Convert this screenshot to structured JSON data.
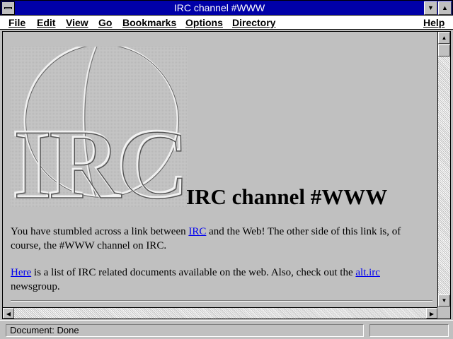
{
  "window": {
    "title": "IRC channel #WWW"
  },
  "menu": {
    "file": "File",
    "edit": "Edit",
    "view": "View",
    "go": "Go",
    "bookmarks": "Bookmarks",
    "options": "Options",
    "directory": "Directory",
    "help": "Help"
  },
  "page": {
    "logo_text": "IRC",
    "heading": "IRC channel #WWW",
    "para1": {
      "before": "You have stumbled across a link between ",
      "link": "IRC",
      "after": " and the Web! The other side of this link is, of course, the #WWW channel on IRC."
    },
    "para2": {
      "link1": "Here",
      "middle": " is a list of IRC related documents available on the web. Also, check out the ",
      "link2": "alt.irc",
      "after": " newsgroup."
    }
  },
  "status": {
    "text": "Document: Done"
  },
  "icons": {
    "minimize": "down-arrow-icon",
    "maximize": "up-arrow-icon",
    "system_menu": "system-menu-icon"
  }
}
